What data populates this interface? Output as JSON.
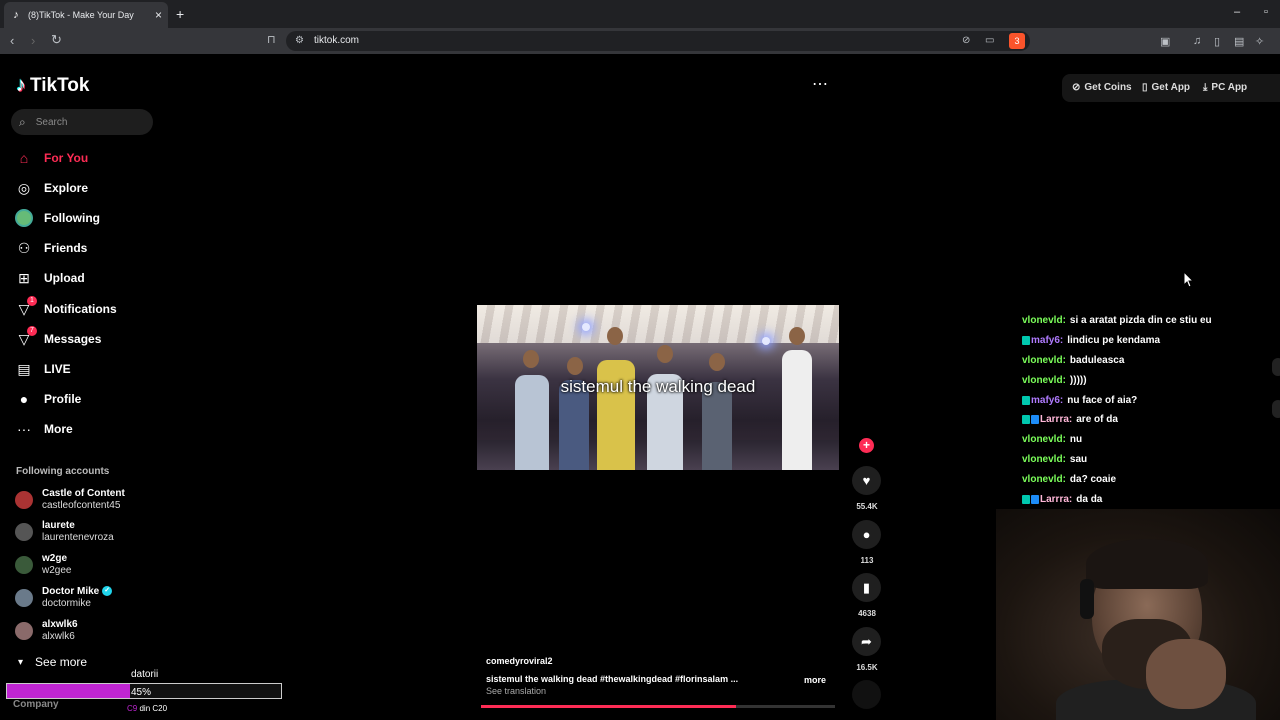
{
  "browser": {
    "tab_title": "(8)TikTok - Make Your Day",
    "url": "tiktok.com",
    "brave_badge": "3"
  },
  "app": {
    "logo_text": "TikTok"
  },
  "search": {
    "placeholder": "Search"
  },
  "nav": [
    {
      "label": "For You",
      "icon": "home-icon",
      "active": true
    },
    {
      "label": "Explore",
      "icon": "compass-icon"
    },
    {
      "label": "Following",
      "icon": "following-avatar"
    },
    {
      "label": "Friends",
      "icon": "friends-icon"
    },
    {
      "label": "Upload",
      "icon": "upload-icon"
    },
    {
      "label": "Notifications",
      "icon": "bell-icon",
      "badge": "1"
    },
    {
      "label": "Messages",
      "icon": "message-icon",
      "badge": "7"
    },
    {
      "label": "LIVE",
      "icon": "live-icon"
    },
    {
      "label": "Profile",
      "icon": "profile-icon"
    },
    {
      "label": "More",
      "icon": "more-icon"
    }
  ],
  "following": {
    "title": "Following accounts",
    "accounts": [
      {
        "name": "Castle of Content",
        "handle": "castleofcontent45"
      },
      {
        "name": "laurete",
        "handle": "laurentenevroza"
      },
      {
        "name": "w2ge",
        "handle": "w2gee"
      },
      {
        "name": "Doctor Mike",
        "handle": "doctormike",
        "verified": true
      },
      {
        "name": "alxwlk6",
        "handle": "alxwlk6"
      }
    ],
    "see_more": "See more"
  },
  "footer": {
    "company": "Company"
  },
  "overlay": {
    "title": "datorii",
    "percent_label": "45%",
    "progress": 0.45,
    "sub_a": "C9",
    "sub_b": "din C20"
  },
  "header": {
    "get_coins": "Get Coins",
    "get_app": "Get App",
    "pc_app": "PC App"
  },
  "video": {
    "caption": "sistemul the walking dead",
    "username": "comedyroviral2",
    "description": "sistemul the walking dead #thewalkingdead  #florinsalam  ...",
    "more": "more",
    "see_translation": "See translation",
    "progress": 0.72,
    "likes": "55.4K",
    "comments": "113",
    "saves": "4638",
    "shares": "16.5K"
  },
  "chat": [
    {
      "user": "vlonevld",
      "text": "si a aratat pizda din ce stiu eu",
      "color": "#7cff5b"
    },
    {
      "user": "mafy6",
      "text": "lindicu pe kendama",
      "color": "#b07bff",
      "badges": 1
    },
    {
      "user": "vlonevld",
      "text": "baduleasca",
      "color": "#7cff5b"
    },
    {
      "user": "vlonevld",
      "text": ")))))",
      "color": "#7cff5b"
    },
    {
      "user": "mafy6",
      "text": "nu face of aia?",
      "color": "#b07bff",
      "badges": 1
    },
    {
      "user": "Larrra",
      "text": "are of da",
      "color": "#ffb7d8",
      "badges": 2
    },
    {
      "user": "vlonevld",
      "text": "nu",
      "color": "#7cff5b"
    },
    {
      "user": "vlonevld",
      "text": "sau",
      "color": "#7cff5b"
    },
    {
      "user": "vlonevld",
      "text": "da? coaie",
      "color": "#7cff5b"
    },
    {
      "user": "Larrra",
      "text": "da da",
      "color": "#ffb7d8",
      "badges": 2
    }
  ],
  "colors": {
    "accent": "#fe2c55",
    "overlay_fill": "#c026d3"
  }
}
